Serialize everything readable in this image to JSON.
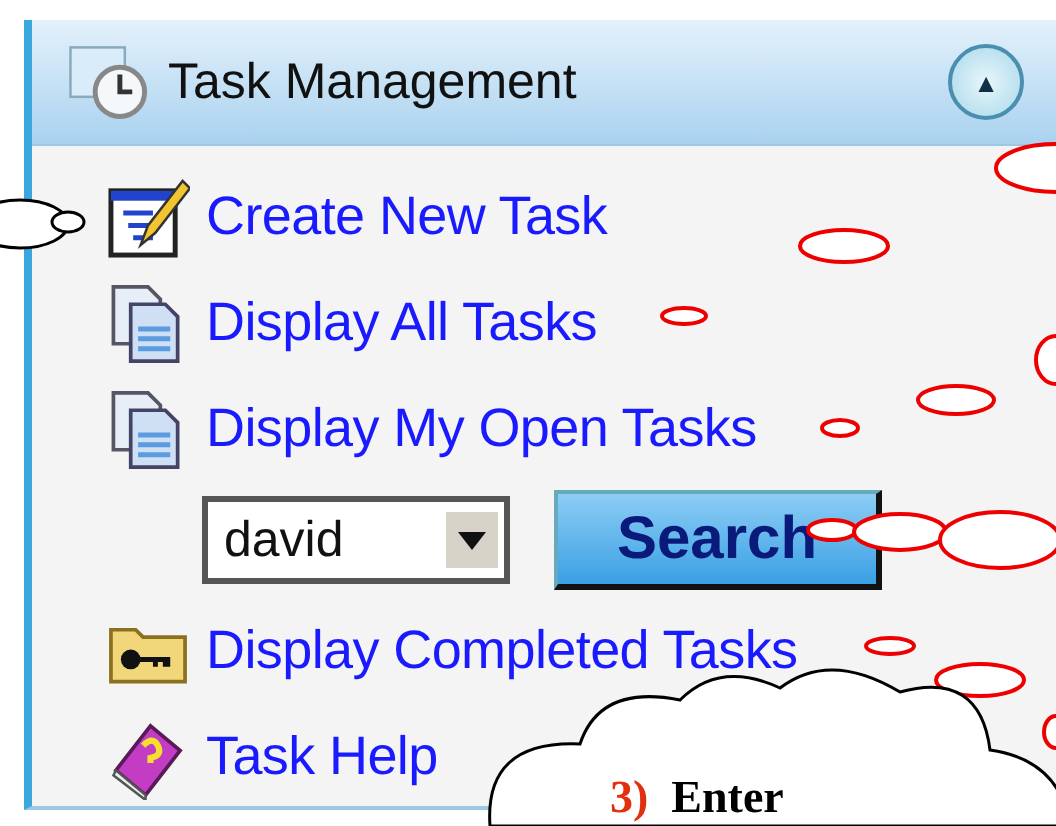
{
  "panel": {
    "title": "Task Management",
    "collapse_button": {
      "symbol": "▲"
    }
  },
  "links": [
    {
      "label": "Create New Task",
      "kind": "create"
    },
    {
      "label": "Display All Tasks",
      "kind": "list"
    },
    {
      "label": "Display My Open Tasks",
      "kind": "list"
    }
  ],
  "user_filter": {
    "value": "david",
    "button": "Search"
  },
  "more_links": [
    {
      "label": "Display Completed Tasks",
      "kind": "folder"
    },
    {
      "label": "Task Help",
      "kind": "help"
    }
  ],
  "callout": {
    "step": "3)",
    "text": "Enter"
  }
}
